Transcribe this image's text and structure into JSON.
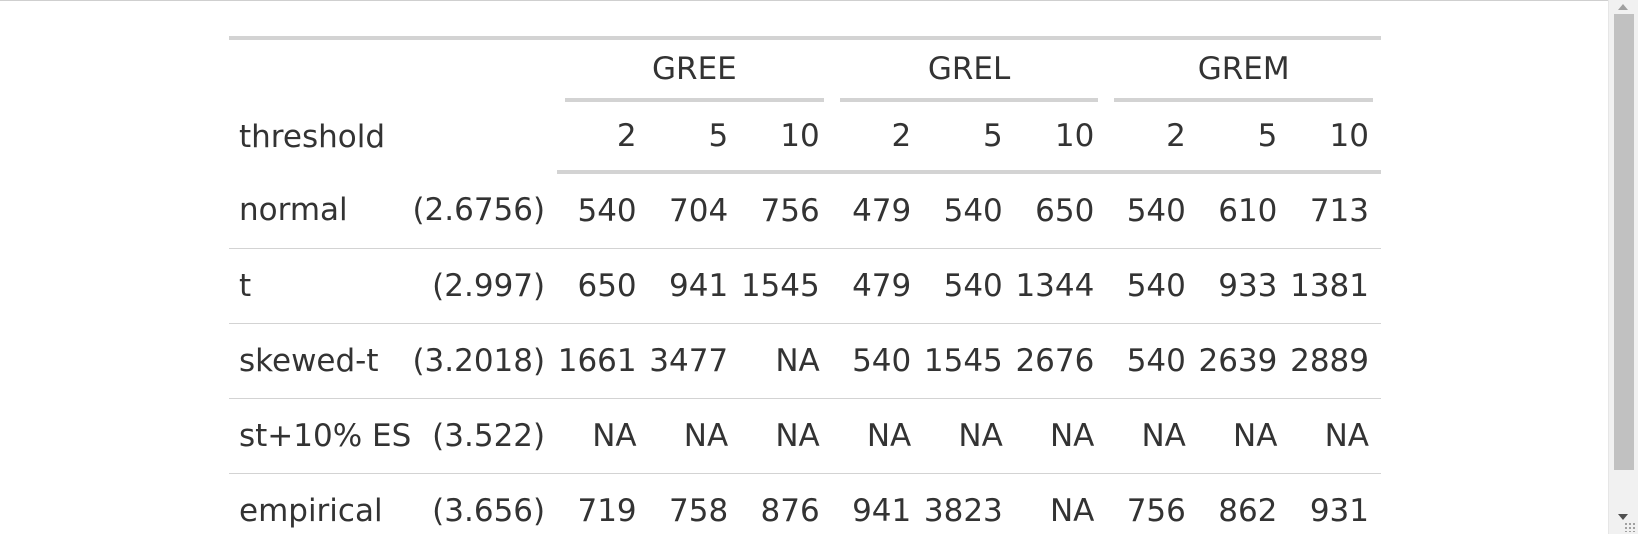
{
  "table": {
    "row_header_label": "threshold",
    "groups": [
      "GREE",
      "GREL",
      "GREM"
    ],
    "sub_columns": [
      "2",
      "5",
      "10",
      "2",
      "5",
      "10",
      "2",
      "5",
      "10"
    ],
    "rows": [
      {
        "name": "normal",
        "threshold": "(2.6756)",
        "values": [
          "540",
          "704",
          "756",
          "479",
          "540",
          "650",
          "540",
          "610",
          "713"
        ]
      },
      {
        "name": "t",
        "threshold": "(2.997)",
        "values": [
          "650",
          "941",
          "1545",
          "479",
          "540",
          "1344",
          "540",
          "933",
          "1381"
        ]
      },
      {
        "name": "skewed-t",
        "threshold": "(3.2018)",
        "values": [
          "1661",
          "3477",
          "NA",
          "540",
          "1545",
          "2676",
          "540",
          "2639",
          "2889"
        ]
      },
      {
        "name": "st+10% ES",
        "threshold": "(3.522)",
        "values": [
          "NA",
          "NA",
          "NA",
          "NA",
          "NA",
          "NA",
          "NA",
          "NA",
          "NA"
        ]
      },
      {
        "name": "empirical",
        "threshold": "(3.656)",
        "values": [
          "719",
          "758",
          "876",
          "941",
          "3823",
          "NA",
          "756",
          "862",
          "931"
        ]
      }
    ]
  }
}
